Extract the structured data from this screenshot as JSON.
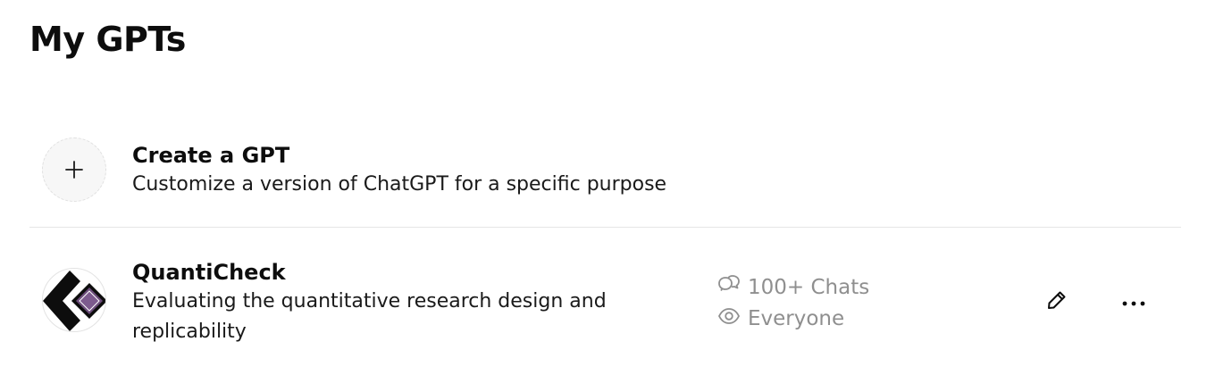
{
  "page": {
    "title": "My GPTs"
  },
  "create": {
    "title": "Create a GPT",
    "description": "Customize a version of ChatGPT for a specific purpose",
    "icon": "plus-icon"
  },
  "gpts": [
    {
      "name": "QuantiCheck",
      "description": "Evaluating the quantitative research design and replicability",
      "chats": "100+ Chats",
      "visibility": "Everyone",
      "avatar_colors": {
        "dark": "#0d0d0d",
        "diamond": "#6b4c7a",
        "diamond_inner": "#7d5b8e"
      }
    }
  ],
  "icons": {
    "chats": "chat-bubbles-icon",
    "visibility": "eye-icon",
    "edit": "pencil-icon",
    "more": "ellipsis-icon"
  },
  "colors": {
    "text": "#0d0d0d",
    "muted": "#8f8f8f",
    "divider": "#e6e6e6"
  }
}
